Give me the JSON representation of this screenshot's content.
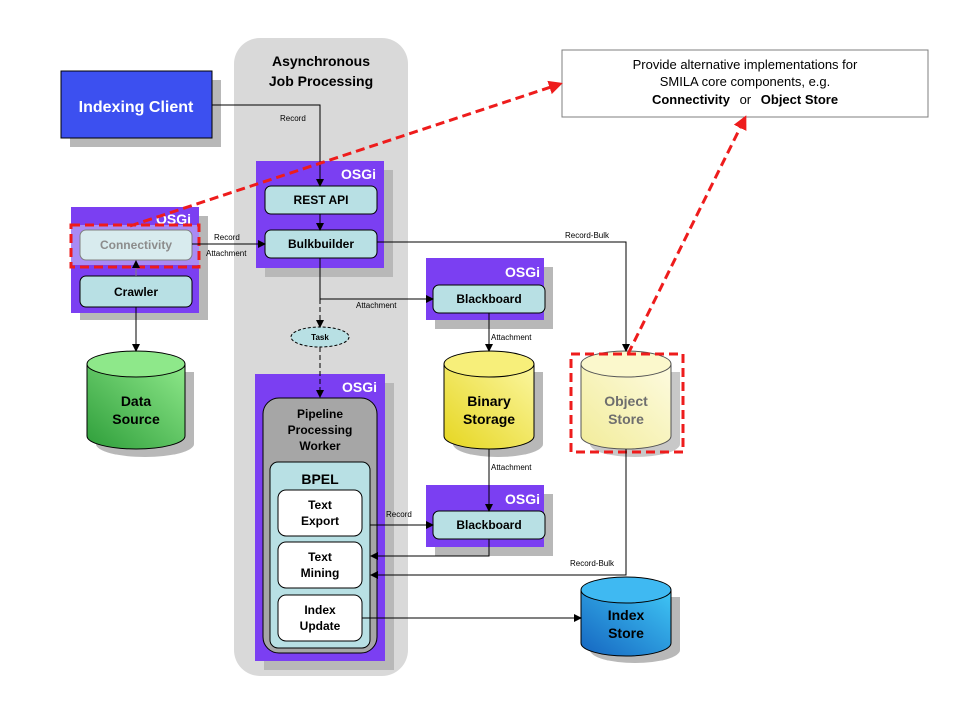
{
  "diagram": {
    "async_panel": {
      "title_line1": "Asynchronous",
      "title_line2": "Job Processing"
    },
    "indexing_client": {
      "label": "Indexing Client",
      "label_part1": "Indexing",
      "label_part2": "Client"
    },
    "callout": {
      "line1": "Provide alternative implementations for",
      "line2": "SMILA core components, e.g.",
      "line3_bold1": "Connectivity",
      "line3_mid": "or",
      "line3_bold2": "Object Store"
    },
    "osgi_label": "OSGi",
    "left_bundle": {
      "connectivity": "Connectivity",
      "crawler": "Crawler"
    },
    "api_bundle": {
      "rest_api": "REST API",
      "bulkbuilder": "Bulkbuilder"
    },
    "blackboard_top": {
      "label": "Blackboard"
    },
    "blackboard_bottom": {
      "label": "Blackboard"
    },
    "task": {
      "label": "Task"
    },
    "worker_bundle": {
      "title_line1": "Pipeline",
      "title_line2": "Processing",
      "title_line3": "Worker",
      "bpel": "BPEL",
      "steps": [
        {
          "line1": "Text",
          "line2": "Export"
        },
        {
          "line1": "Text",
          "line2": "Mining"
        },
        {
          "line1": "Index",
          "line2": "Update"
        }
      ]
    },
    "stores": {
      "data_source": {
        "line1": "Data",
        "line2": "Source",
        "color": "#3cb043"
      },
      "binary_storage": {
        "line1": "Binary",
        "line2": "Storage",
        "color": "#f0e442"
      },
      "object_store": {
        "line1": "Object",
        "line2": "Store",
        "color": "#f5f0a8"
      },
      "index_store": {
        "line1": "Index",
        "line2": "Store",
        "color": "#1e88e5"
      }
    },
    "edge_labels": {
      "client_record": "Record",
      "conn_record": "Record",
      "conn_attachment": "Attachment",
      "bulk_attachment": "Attachment",
      "bulk_record_bulk": "Record-Bulk",
      "bb_attachment_down": "Attachment",
      "bs_attachment_down": "Attachment",
      "export_record": "Record",
      "os_record_bulk": "Record-Bulk"
    },
    "colors": {
      "osgi_purple": "#7b3ff2",
      "client_blue": "#3c50f0",
      "box_cyan": "#b8e0e4",
      "highlight_red": "#ee1c1c",
      "panel_gray": "#d9d9d9"
    }
  }
}
